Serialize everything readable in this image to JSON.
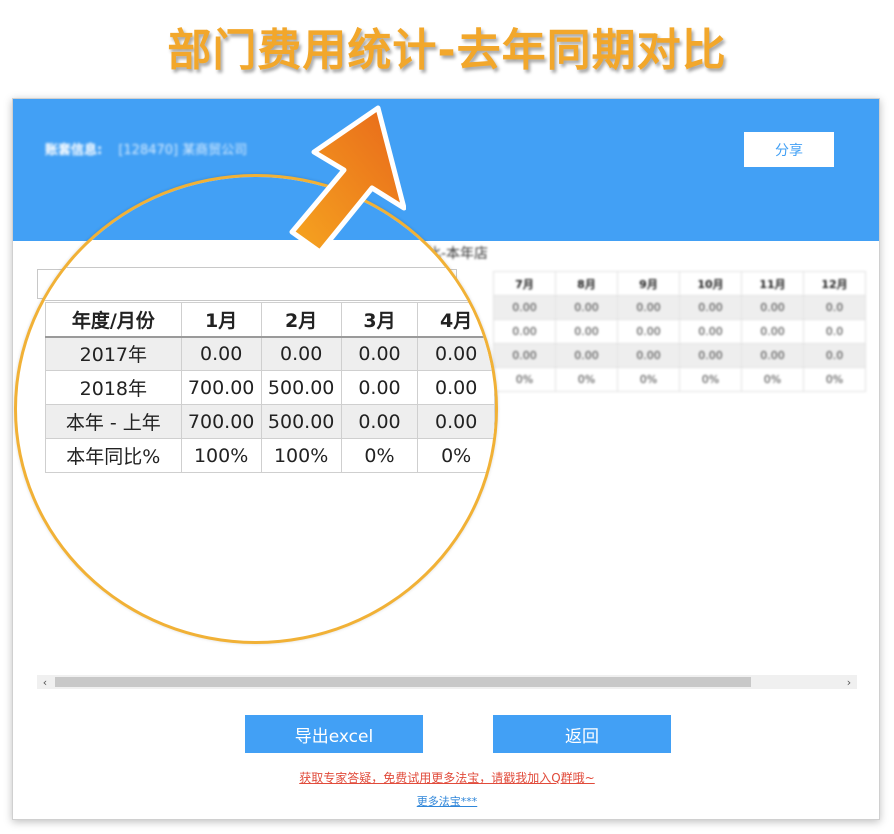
{
  "headline": "部门费用统计-去年同期对比",
  "header": {
    "account_label": "账套信息:",
    "account_value": "[128470] 某商贸公司",
    "share_label": "分享"
  },
  "background_table": {
    "title": "比-本年店",
    "header": [
      "7月",
      "8月",
      "9月",
      "10月",
      "11月",
      "12月"
    ],
    "rows": [
      [
        "0.00",
        "0.00",
        "0.00",
        "0.00",
        "0.00",
        "0.0"
      ],
      [
        "0.00",
        "0.00",
        "0.00",
        "0.00",
        "0.00",
        "0.0"
      ],
      [
        "0.00",
        "0.00",
        "0.00",
        "0.00",
        "0.00",
        "0.0"
      ],
      [
        "0%",
        "0%",
        "0%",
        "0%",
        "0%",
        "0%"
      ]
    ]
  },
  "zoom_table": {
    "columns": [
      "年度/月份",
      "1月",
      "2月",
      "3月",
      "4月"
    ],
    "rows": [
      [
        "2017年",
        "0.00",
        "0.00",
        "0.00",
        "0.00"
      ],
      [
        "2018年",
        "700.00",
        "500.00",
        "0.00",
        "0.00"
      ],
      [
        "本年 - 上年",
        "700.00",
        "500.00",
        "0.00",
        "0.00"
      ],
      [
        "本年同比%",
        "100%",
        "100%",
        "0%",
        "0%"
      ]
    ]
  },
  "scrollbar": {
    "left_arrow": "‹",
    "right_arrow": "›"
  },
  "buttons": {
    "export_label": "导出excel",
    "back_label": "返回"
  },
  "footer": {
    "help_text": "获取专家答疑，免费试用更多法宝，请戳我加入Q群哦~",
    "more_text": "更多法宝***"
  },
  "colors": {
    "accent": "#42a0f5",
    "headline": "#f2a72b",
    "circle": "#f1b136",
    "arrow_start": "#f6a520",
    "arrow_end": "#e8681a",
    "help_link": "#e14b3b"
  }
}
